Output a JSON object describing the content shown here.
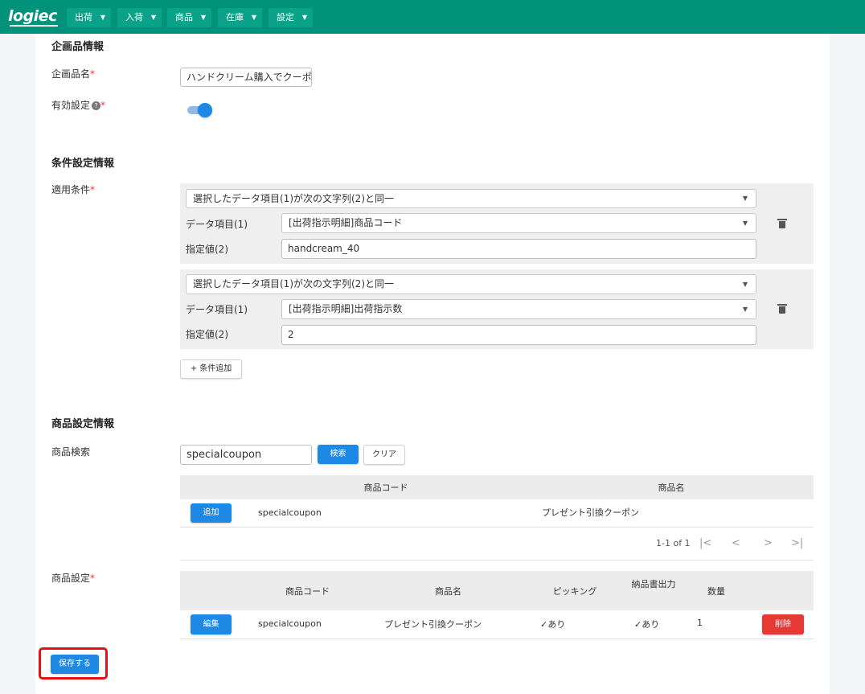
{
  "app": {
    "logo": "logiec"
  },
  "nav": [
    {
      "label": "出荷"
    },
    {
      "label": "入荷"
    },
    {
      "label": "商品"
    },
    {
      "label": "在庫"
    },
    {
      "label": "設定"
    }
  ],
  "icons": {
    "dropdown": "caret-down",
    "help": "help-circle",
    "delete": "trash",
    "add": "plus"
  },
  "colors": {
    "header": "#00927a",
    "primary": "#1e88e5",
    "danger": "#e53935",
    "highlight": "#e01414"
  },
  "plan": {
    "section_title": "企画品情報",
    "name_label": "企画品名",
    "name_value": "ハンドクリーム購入でクーポン",
    "enabled_label": "有効設定",
    "help_glyph": "?",
    "enabled": true
  },
  "required_mark": "*",
  "conditions": {
    "section_title": "条件設定情報",
    "label": "適用条件",
    "item_label": "データ項目(1)",
    "value_label": "指定値(2)",
    "rules": [
      {
        "operator": "選択したデータ項目(1)が次の文字列(2)と同一",
        "item": "[出荷指示明細]商品コード",
        "value": "handcream_40"
      },
      {
        "operator": "選択したデータ項目(1)が次の文字列(2)と同一",
        "item": "[出荷指示明細]出荷指示数",
        "value": "2"
      }
    ],
    "add_button": "+ 条件追加"
  },
  "product": {
    "section_title": "商品設定情報",
    "search_label": "商品検索",
    "search_value": "specialcoupon",
    "search_button": "検索",
    "clear_button": "クリア",
    "search_table": {
      "columns": [
        "商品コード",
        "商品名"
      ],
      "rows": [
        {
          "action": "追加",
          "code": "specialcoupon",
          "name": "プレゼント引換クーポン"
        }
      ],
      "pagination": "1-1 of 1",
      "pager_icons": [
        "|<",
        "<",
        ">",
        ">|"
      ]
    },
    "settings_label": "商品設定",
    "settings_table": {
      "columns": [
        "商品コード",
        "商品名",
        "ピッキング",
        "納品書出力",
        "数量"
      ],
      "rows": [
        {
          "action": "編集",
          "code": "specialcoupon",
          "name": "プレゼント引換クーポン",
          "picking": "✓あり",
          "invoice": "✓あり",
          "quantity": "1",
          "delete": "削除"
        }
      ]
    }
  },
  "save_button": "保存する"
}
